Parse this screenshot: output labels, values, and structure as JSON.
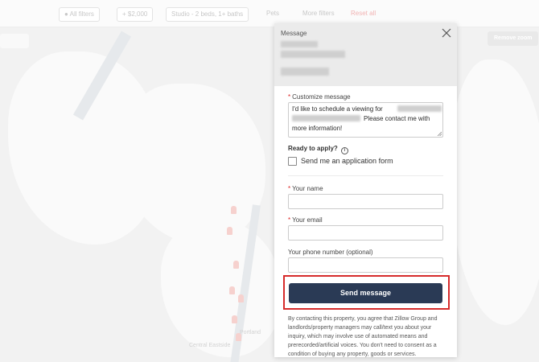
{
  "filters": {
    "all_filters": "All filters",
    "price": "+ $2,000",
    "beds": "Studio - 2 beds, 1+ baths",
    "pets": "Pets",
    "more": "More filters",
    "reset": "Reset all"
  },
  "map": {
    "button_right": "Remove zoom",
    "city_label": "Portland",
    "district_label": "Central Eastside"
  },
  "modal": {
    "title": "Message",
    "customize_label": "Customize message",
    "message_line1": "I'd like to schedule a viewing for",
    "message_line2": "Please contact me with",
    "message_line3": "more information!",
    "ready_label": "Ready to apply?",
    "help_icon_glyph": "i",
    "application_checkbox_label": "Send me an application form",
    "name_label": "Your name",
    "email_label": "Your email",
    "phone_label": "Your phone number (optional)",
    "send_button": "Send message",
    "disclaimer": "By contacting this property, you agree that Zillow Group and landlords/property managers may call/text you about your inquiry, which may involve use of automated means and prerecorded/artificial voices. You don't need to consent as a condition of buying any property, goods or services.",
    "required_marker": "*"
  },
  "colors": {
    "send_button_bg": "#2a3a55",
    "highlight_border": "#d62b2b",
    "required": "#dd2222"
  }
}
